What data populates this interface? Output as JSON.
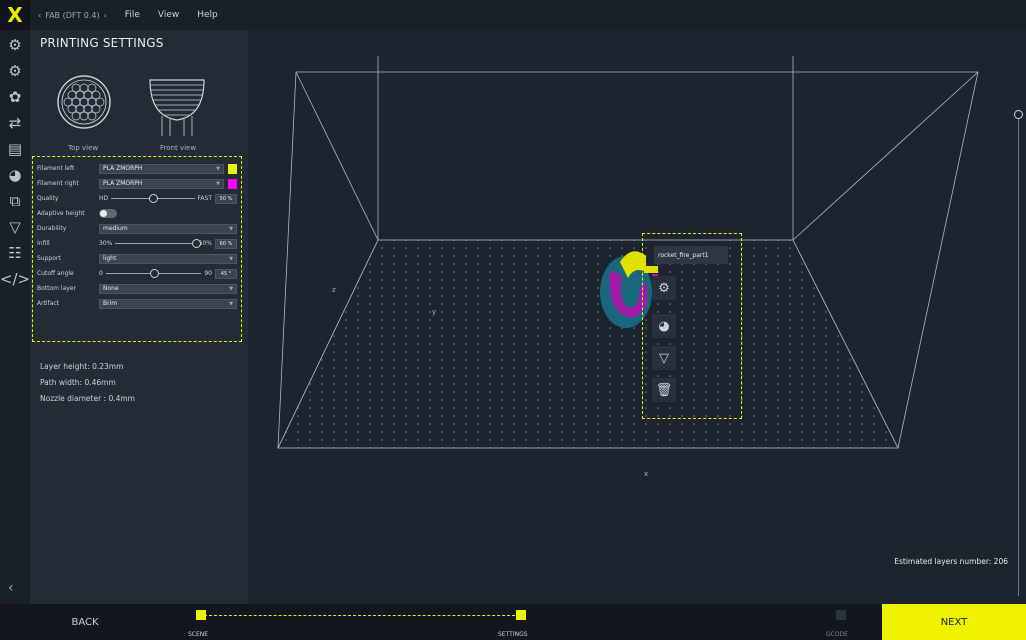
{
  "app": {
    "logo": "X"
  },
  "topbar": {
    "printer": "FAB (DFT 0.4)",
    "menus": [
      "File",
      "View",
      "Help"
    ]
  },
  "rail": {
    "icons": [
      "gear-icon",
      "gear-plus-icon",
      "palette-gear-icon",
      "swap-gear-icon",
      "table-gear-icon",
      "palette-icon",
      "copy-icon",
      "funnel-icon",
      "network-icon",
      "code-icon"
    ],
    "collapse": "‹"
  },
  "panel": {
    "title": "PRINTING SETTINGS",
    "top_view_label": "Top view",
    "front_view_label": "Front view",
    "settings": {
      "filament_left": {
        "label": "Filament left",
        "value": "PLA ZMORPH",
        "color": "#f0f300"
      },
      "filament_right": {
        "label": "Filament right",
        "value": "PLA ZMORPH",
        "color": "#ff00ff"
      },
      "quality": {
        "label": "Quality",
        "min": "HD",
        "max": "FAST",
        "value": "50 %",
        "level": 0.5
      },
      "adaptive_height": {
        "label": "Adaptive height",
        "on": false
      },
      "durability": {
        "label": "Durability",
        "value": "medium"
      },
      "infill": {
        "label": "Infill",
        "min": "30%",
        "max": "60%",
        "value": "60 %",
        "level": 1.0
      },
      "support": {
        "label": "Support",
        "value": "light"
      },
      "cutoff_angle": {
        "label": "Cutoff angle",
        "min": "0",
        "max": "90",
        "value": "45 °",
        "level": 0.5
      },
      "bottom_layer": {
        "label": "Bottom layer",
        "value": "None"
      },
      "artifact": {
        "label": "Artifact",
        "value": "Brim"
      }
    },
    "info": {
      "layer_height": "Layer height: 0.23mm",
      "path_width": "Path width: 0.46mm",
      "nozzle_diameter": "Nozzle diameter : 0.4mm"
    }
  },
  "viewport": {
    "object_name": "rocket_fire_part1",
    "axis_z": "z",
    "axis_y": "y",
    "axis_x": "x",
    "layers_label": "Estimated layers number: 206"
  },
  "bottombar": {
    "back": "BACK",
    "next": "NEXT",
    "steps": [
      "SCENE",
      "SETTINGS",
      "GCODE"
    ]
  }
}
